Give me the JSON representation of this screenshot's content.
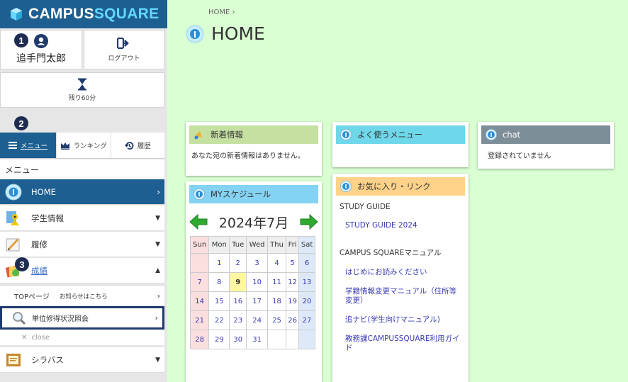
{
  "brand": {
    "name_a": "CAMPUS",
    "name_b": "SQUARE"
  },
  "user": {
    "name": "追手門太郎",
    "logout_label": "ログアウト",
    "timer_label": "残り60分"
  },
  "badges": [
    "1",
    "2",
    "3"
  ],
  "tabs": [
    {
      "label": "メニュー",
      "icon": "hamburger-icon"
    },
    {
      "label": "ランキング",
      "icon": "crown-icon"
    },
    {
      "label": "履歴",
      "icon": "history-icon"
    }
  ],
  "menu_heading": "メニュー",
  "menu": {
    "home": "HOME",
    "student_info": "学生情報",
    "course": "履修",
    "grades": "成績",
    "syllabus": "シラバス"
  },
  "grades_sub": {
    "top_label": "TOPページ",
    "top_note": "お知らせはこちら",
    "credits_label": "単位修得状況照会",
    "close_label": "close"
  },
  "main": {
    "breadcrumb": "HOME ›",
    "title": "HOME"
  },
  "news": {
    "title": "新着情報",
    "body": "あなた宛の新着情報はありません。"
  },
  "frequent": {
    "title": "よく使うメニュー"
  },
  "chat": {
    "title": "chat",
    "body": "登録されていません"
  },
  "schedule": {
    "title": "MYスケジュール",
    "month_label": "2024年7月",
    "weekdays": [
      "Sun",
      "Mon",
      "Tue",
      "Wed",
      "Thu",
      "Fri",
      "Sat"
    ],
    "weeks": [
      [
        "",
        "1",
        "2",
        "3",
        "4",
        "5",
        "6"
      ],
      [
        "7",
        "8",
        "9",
        "10",
        "11",
        "12",
        "13"
      ],
      [
        "14",
        "15",
        "16",
        "17",
        "18",
        "19",
        "20"
      ],
      [
        "21",
        "22",
        "23",
        "24",
        "25",
        "26",
        "27"
      ],
      [
        "28",
        "29",
        "30",
        "31",
        "",
        "",
        ""
      ]
    ],
    "today": "9"
  },
  "favorites": {
    "title": "お気に入り・リンク",
    "group1": "STUDY GUIDE",
    "link1": "STUDY GUIDE 2024",
    "group2": "CAMPUS SQUAREマニュアル",
    "link2": "はじめにお読みください",
    "link3": "学籍情報変更マニュアル（住所等変更）",
    "link4": "追ナビ(学生向けマニュアル)",
    "link5": "教務課CAMPUSSQUARE利用ガイド"
  },
  "colors": {
    "brand_blue": "#1d5f91",
    "page_bg": "#d9ffd2",
    "highlight_border": "#1f3a6e",
    "badge": "#1f2c52"
  }
}
